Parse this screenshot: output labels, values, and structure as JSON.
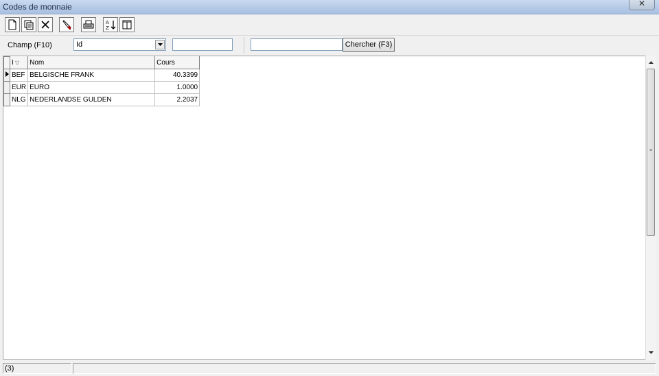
{
  "window": {
    "title": "Codes de monnaie",
    "close_symbol": "✕"
  },
  "toolbar": {
    "buttons": [
      {
        "name": "new-icon"
      },
      {
        "name": "copy-icon"
      },
      {
        "name": "delete-icon"
      },
      {
        "name": "edit-icon"
      },
      {
        "name": "print-icon"
      },
      {
        "name": "sort-icon"
      },
      {
        "name": "columns-icon"
      }
    ]
  },
  "filter": {
    "field_label": "Champ (F10)",
    "field_value": "Id",
    "value_input": "",
    "search_input": "",
    "search_button": "Chercher (F3)"
  },
  "grid": {
    "columns": [
      "I",
      "Nom",
      "Cours"
    ],
    "rows": [
      {
        "id": "BEF",
        "name": "BELGISCHE FRANK",
        "rate": "40.3399"
      },
      {
        "id": "EUR",
        "name": "EURO",
        "rate": "1.0000"
      },
      {
        "id": "NLG",
        "name": "NEDERLANDSE GULDEN",
        "rate": "2.2037"
      }
    ]
  },
  "status": {
    "count": "(3)"
  }
}
